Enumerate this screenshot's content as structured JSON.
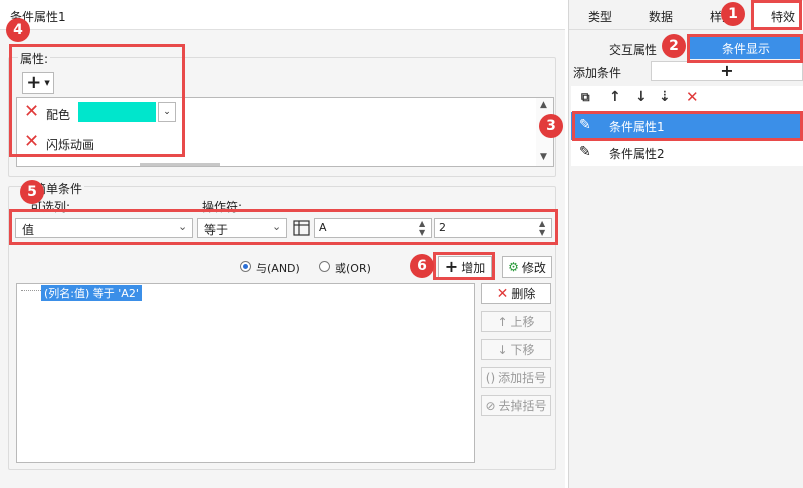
{
  "dialog": {
    "title": "条件属性1"
  },
  "properties": {
    "label": "属性:",
    "add_icon": "+",
    "items": [
      "配色",
      "闪烁动画"
    ],
    "color_value": "#00e6cc"
  },
  "condition": {
    "legend": "简单条件",
    "column_label": "可选列:",
    "operator_label": "操作符:",
    "column_value": "值",
    "operator_value": "等于",
    "value_field": "A",
    "number_field": "2",
    "and_label": "与(AND)",
    "or_label": "或(OR)",
    "selected_logic": "and",
    "add_button": "增加",
    "modify_button": "修改",
    "delete_button": "删除",
    "up_button": "上移",
    "down_button": "下移",
    "add_bracket_button": "添加括号",
    "remove_bracket_button": "去掉括号",
    "list_items": [
      "(列名:值) 等于 'A2'"
    ]
  },
  "right_panel": {
    "tabs": [
      "类型",
      "数据",
      "样式",
      "特效"
    ],
    "active_tab": "特效",
    "subtabs": [
      "交互属性",
      "条件显示"
    ],
    "active_subtab": "条件显示",
    "add_condition_label": "添加条件",
    "add_condition_icon": "+",
    "conditions": [
      "条件属性1",
      "条件属性2"
    ],
    "selected_condition": "条件属性1"
  },
  "badges": [
    "1",
    "2",
    "3",
    "4",
    "5",
    "6"
  ],
  "colors": {
    "accent_blue": "#3b8fe8",
    "red": "#e84a4a",
    "teal": "#00e6cc"
  }
}
